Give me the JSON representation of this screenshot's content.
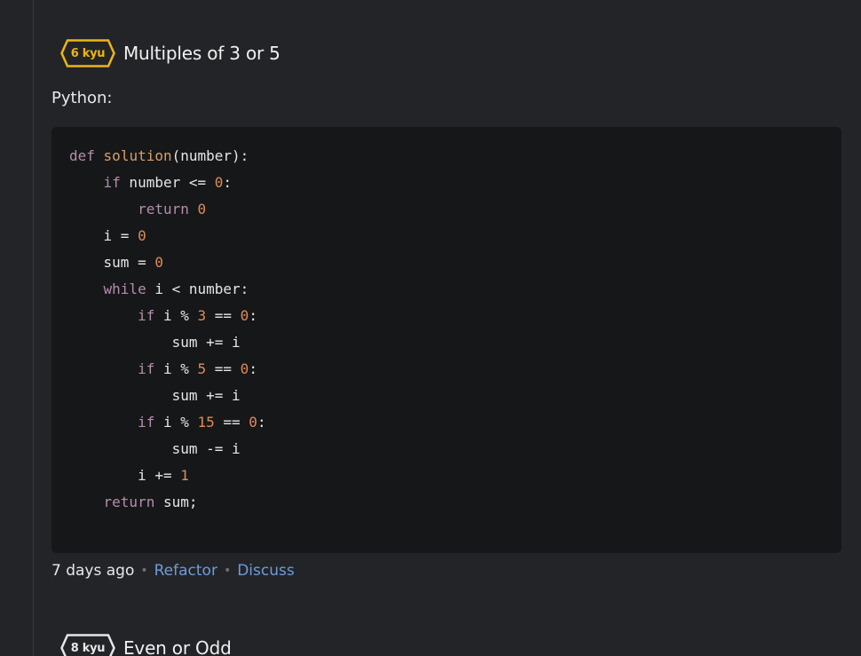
{
  "katas": [
    {
      "rank": "6 kyu",
      "rank_color": "#ecb613",
      "title": "Multiples of 3 or 5",
      "language": "Python:",
      "code_lines": [
        [
          [
            "kw",
            "def"
          ],
          [
            "pl",
            " "
          ],
          [
            "fn",
            "solution"
          ],
          [
            "pl",
            "(number):"
          ]
        ],
        [
          [
            "pl",
            "    "
          ],
          [
            "kw",
            "if"
          ],
          [
            "pl",
            " number <= "
          ],
          [
            "num",
            "0"
          ],
          [
            "pl",
            ":"
          ]
        ],
        [
          [
            "pl",
            "        "
          ],
          [
            "kw",
            "return"
          ],
          [
            "pl",
            " "
          ],
          [
            "num",
            "0"
          ]
        ],
        [
          [
            "pl",
            "    i = "
          ],
          [
            "num",
            "0"
          ]
        ],
        [
          [
            "pl",
            "    sum = "
          ],
          [
            "num",
            "0"
          ]
        ],
        [
          [
            "pl",
            "    "
          ],
          [
            "kw",
            "while"
          ],
          [
            "pl",
            " i < number:"
          ]
        ],
        [
          [
            "pl",
            "        "
          ],
          [
            "kw",
            "if"
          ],
          [
            "pl",
            " i % "
          ],
          [
            "num",
            "3"
          ],
          [
            "pl",
            " == "
          ],
          [
            "num",
            "0"
          ],
          [
            "pl",
            ":"
          ]
        ],
        [
          [
            "pl",
            "            sum += i"
          ]
        ],
        [
          [
            "pl",
            "        "
          ],
          [
            "kw",
            "if"
          ],
          [
            "pl",
            " i % "
          ],
          [
            "num",
            "5"
          ],
          [
            "pl",
            " == "
          ],
          [
            "num",
            "0"
          ],
          [
            "pl",
            ":"
          ]
        ],
        [
          [
            "pl",
            "            sum += i"
          ]
        ],
        [
          [
            "pl",
            "        "
          ],
          [
            "kw",
            "if"
          ],
          [
            "pl",
            " i % "
          ],
          [
            "num",
            "15"
          ],
          [
            "pl",
            " == "
          ],
          [
            "num",
            "0"
          ],
          [
            "pl",
            ":"
          ]
        ],
        [
          [
            "pl",
            "            sum -= i"
          ]
        ],
        [
          [
            "pl",
            "        i += "
          ],
          [
            "num",
            "1"
          ]
        ],
        [
          [
            "pl",
            "    "
          ],
          [
            "kw",
            "return"
          ],
          [
            "pl",
            " sum;"
          ]
        ]
      ],
      "time_ago": "7 days ago",
      "refactor_label": "Refactor",
      "discuss_label": "Discuss"
    },
    {
      "rank": "8 kyu",
      "rank_color": "#e6e6e6",
      "title": "Even or Odd"
    }
  ]
}
